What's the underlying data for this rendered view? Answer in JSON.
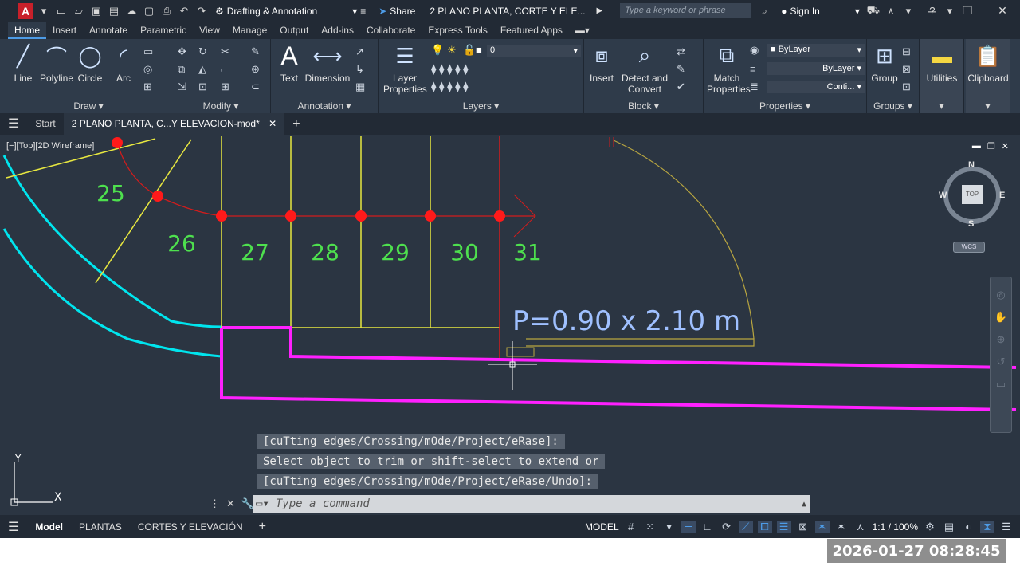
{
  "title_bar": {
    "logo": "A",
    "workspace": "Drafting & Annotation",
    "share": "Share",
    "doc_title": "2 PLANO PLANTA, CORTE Y ELE...",
    "search_placeholder": "Type a keyword or phrase",
    "signin": "Sign In"
  },
  "ribbon_tabs": [
    "Home",
    "Insert",
    "Annotate",
    "Parametric",
    "View",
    "Manage",
    "Output",
    "Add-ins",
    "Collaborate",
    "Express Tools",
    "Featured Apps"
  ],
  "ribbon": {
    "draw": {
      "title": "Draw",
      "line": "Line",
      "polyline": "Polyline",
      "circle": "Circle",
      "arc": "Arc"
    },
    "modify": {
      "title": "Modify"
    },
    "annotation": {
      "title": "Annotation",
      "text": "Text",
      "dimension": "Dimension"
    },
    "layers": {
      "title": "Layers",
      "layer_properties_1": "Layer",
      "layer_properties_2": "Properties",
      "current_layer": "0"
    },
    "block": {
      "title": "Block",
      "insert": "Insert",
      "detect_1": "Detect and",
      "detect_2": "Convert"
    },
    "properties": {
      "title": "Properties",
      "match_1": "Match",
      "match_2": "Properties",
      "color": "ByLayer",
      "lineweight": "ByLayer",
      "linetype": "Conti..."
    },
    "groups": {
      "title": "Groups",
      "group": "Group"
    },
    "utilities": "Utilities",
    "clipboard": "Clipboard"
  },
  "doc_tabs": {
    "start": "Start",
    "active": "2 PLANO PLANTA, C...Y ELEVACION-mod*"
  },
  "viewport": {
    "label": "[−][Top][2D Wireframe]",
    "compass": {
      "n": "N",
      "s": "S",
      "e": "E",
      "w": "W",
      "top": "TOP",
      "wcs": "WCS"
    },
    "room_numbers": [
      "25",
      "26",
      "27",
      "28",
      "29",
      "30",
      "31"
    ],
    "door_label": "P=0.90 x 2.10 m"
  },
  "command": {
    "history": [
      "[cuTting edges/Crossing/mOde/Project/eRase]:",
      "Select object to trim or shift-select to extend or",
      "[cuTting edges/Crossing/mOde/Project/eRase/Undo]:"
    ],
    "placeholder": "Type a command"
  },
  "status_bar": {
    "layouts": [
      "Model",
      "PLANTAS",
      "CORTES Y ELEVACIÓN"
    ],
    "model": "MODEL",
    "scale": "1:1 / 100%"
  },
  "timestamp": "2026-01-27  08:28:45",
  "colors": {
    "cyan": "#00e5ee",
    "magenta": "#ff20ff",
    "red": "#ff1a1a",
    "yellow": "#e8e840",
    "green": "#4ee04e",
    "text_blue": "#9fc0ff"
  }
}
